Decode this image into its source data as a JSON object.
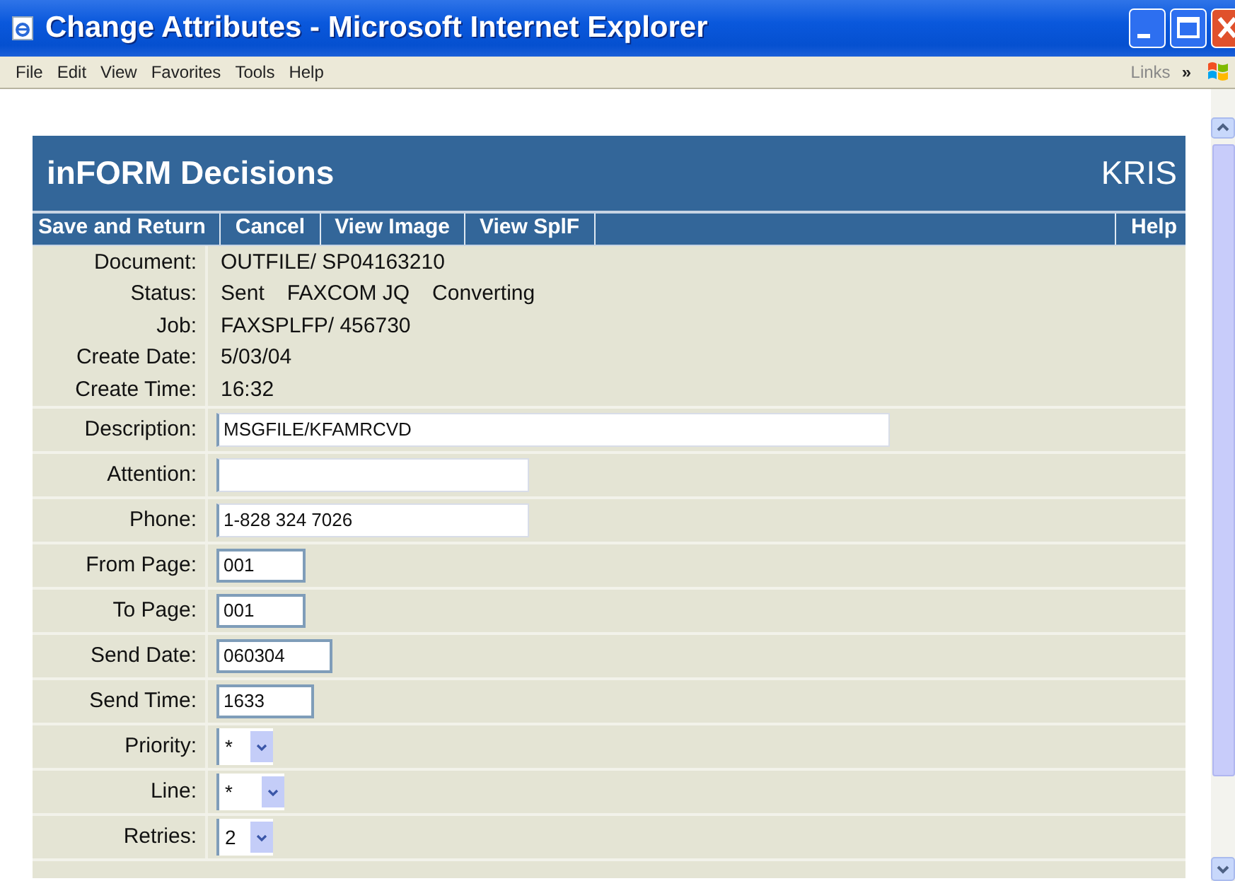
{
  "window": {
    "title": "Change Attributes - Microsoft Internet Explorer"
  },
  "menu_bar": {
    "items": [
      "File",
      "Edit",
      "View",
      "Favorites",
      "Tools",
      "Help"
    ],
    "links_label": "Links",
    "chevron": "»"
  },
  "app": {
    "title": "inFORM Decisions",
    "user": "KRIS"
  },
  "nav": {
    "left": [
      "Save and Return",
      "Cancel",
      "View Image",
      "View SplF"
    ],
    "right": [
      "Help"
    ]
  },
  "info": [
    {
      "label": "Document:",
      "values": [
        "OUTFILE/ SP04163210"
      ]
    },
    {
      "label": "Status:",
      "values": [
        "Sent",
        "FAXCOM JQ",
        "Converting"
      ]
    },
    {
      "label": "Job:",
      "values": [
        "FAXSPLFP/ 456730"
      ]
    },
    {
      "label": "Create Date:",
      "values": [
        "5/03/04"
      ]
    },
    {
      "label": "Create Time:",
      "values": [
        "16:32"
      ]
    }
  ],
  "fields": [
    {
      "label": "Description:",
      "kind": "text",
      "value": "MSGFILE/KFAMRCVD"
    },
    {
      "label": "Attention:",
      "kind": "text"
    },
    {
      "label": "Phone:",
      "kind": "text",
      "value": "1-828 324 7026"
    },
    {
      "label": "From Page:",
      "kind": "text",
      "value": "001"
    },
    {
      "label": "To Page:",
      "kind": "text",
      "value": "001"
    },
    {
      "label": "Send Date:",
      "kind": "text",
      "value": "060304"
    },
    {
      "label": "Send Time:",
      "kind": "text",
      "value": "1633"
    },
    {
      "label": "Priority:",
      "kind": "select",
      "value": "*"
    },
    {
      "label": "Line:",
      "kind": "select",
      "value": "*"
    },
    {
      "label": "Retries:",
      "kind": "select",
      "value": "2"
    }
  ]
}
